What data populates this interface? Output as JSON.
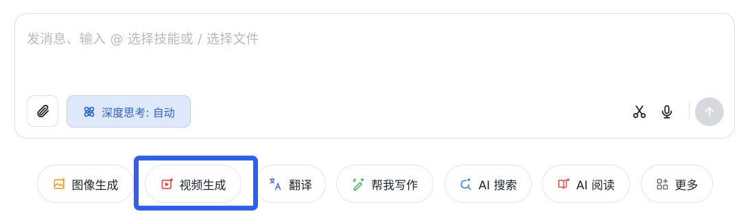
{
  "composer": {
    "placeholder": "发消息、输入 @ 选择技能或 / 选择文件",
    "deep_think_label": "深度思考: 自动"
  },
  "icons": {
    "attach": "paperclip-icon",
    "deep_think": "atom-icon",
    "scissors": "scissors-icon",
    "microphone": "microphone-icon",
    "send": "arrow-up-icon"
  },
  "quick_actions": [
    {
      "label": "图像生成",
      "icon": "image-gen-icon",
      "color": "#f29b1f"
    },
    {
      "label": "视频生成",
      "icon": "video-gen-icon",
      "color": "#e9423a"
    },
    {
      "label": "翻译",
      "icon": "translate-icon",
      "color": "#5b6cff"
    },
    {
      "label": "帮我写作",
      "icon": "pen-sparkle-icon",
      "color": "#3fb25a"
    },
    {
      "label": "AI 搜索",
      "icon": "search-sparkle-icon",
      "color": "#3a7df0"
    },
    {
      "label": "AI 阅读",
      "icon": "book-sparkle-icon",
      "color": "#ee4b4b"
    },
    {
      "label": "更多",
      "icon": "grid-more-icon",
      "color": "#6d7280"
    }
  ],
  "colors": {
    "accent": "#2f5fd6",
    "highlight_border": "#2f5ff2",
    "send_disabled": "#d7d9de"
  }
}
